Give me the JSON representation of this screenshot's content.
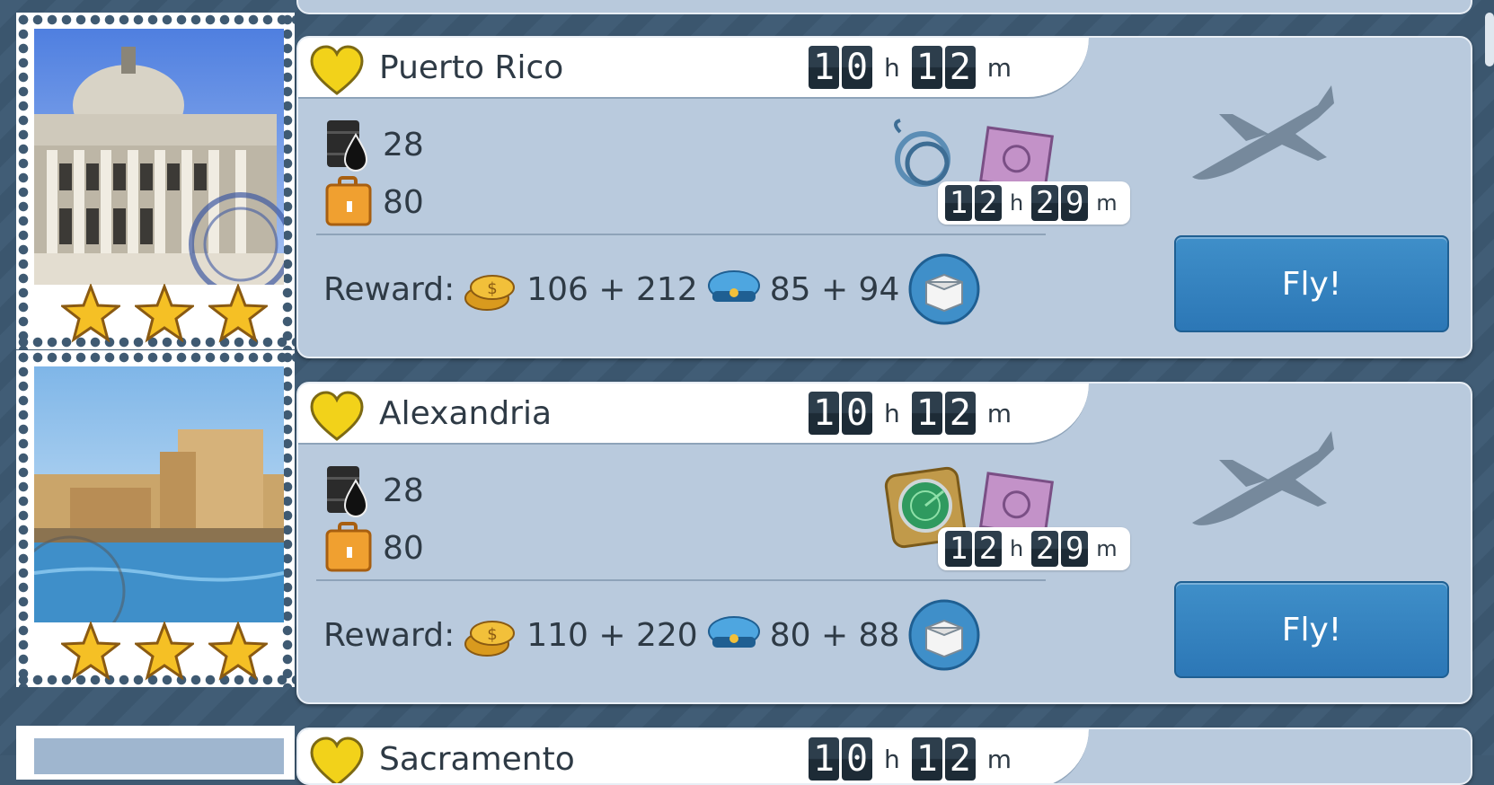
{
  "flights": [
    {
      "city": "Puerto Rico",
      "time": {
        "h": "10",
        "m": "12",
        "h_unit": "h",
        "m_unit": "m"
      },
      "fuel": "28",
      "passengers": "80",
      "cargo_time": {
        "h": "12",
        "m": "29",
        "h_unit": "h",
        "m_unit": "m"
      },
      "cargo_items": [
        "hose-icon",
        "map-icon"
      ],
      "reward_label": "Reward:",
      "coins": "106 + 212",
      "crew": "85 + 94",
      "fly_label": "Fly!",
      "stars": 3,
      "photo": "capitol-building"
    },
    {
      "city": "Alexandria",
      "time": {
        "h": "10",
        "m": "12",
        "h_unit": "h",
        "m_unit": "m"
      },
      "fuel": "28",
      "passengers": "80",
      "cargo_time": {
        "h": "12",
        "m": "29",
        "h_unit": "h",
        "m_unit": "m"
      },
      "cargo_items": [
        "radar-icon",
        "map-icon"
      ],
      "reward_label": "Reward:",
      "coins": "110 + 220",
      "crew": "80 + 88",
      "fly_label": "Fly!",
      "stars": 3,
      "photo": "citadel-harbor"
    },
    {
      "city": "Sacramento",
      "time": {
        "h": "10",
        "m": "12",
        "h_unit": "h",
        "m_unit": "m"
      }
    }
  ],
  "colors": {
    "card": "#b9cadd",
    "fly": "#2c77b6",
    "heart": "#f2d21a"
  }
}
